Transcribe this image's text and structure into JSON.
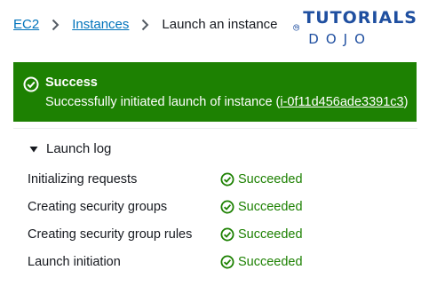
{
  "breadcrumb": {
    "items": [
      "EC2",
      "Instances"
    ],
    "current": "Launch an instance"
  },
  "logo": {
    "mark": "TD",
    "line1": "TUTORIALS",
    "line2": "DOJO"
  },
  "flash": {
    "title": "Success",
    "message_prefix": "Successfully initiated launch of instance (",
    "instance_id": "i-0f11d456ade3391c3",
    "message_suffix": ")",
    "icon": "check-circle-icon",
    "color": "#1d8102"
  },
  "launch_log": {
    "title": "Launch log",
    "rows": [
      {
        "label": "Initializing requests",
        "status": "Succeeded"
      },
      {
        "label": "Creating security groups",
        "status": "Succeeded"
      },
      {
        "label": "Creating security group rules",
        "status": "Succeeded"
      },
      {
        "label": "Launch initiation",
        "status": "Succeeded"
      }
    ]
  }
}
